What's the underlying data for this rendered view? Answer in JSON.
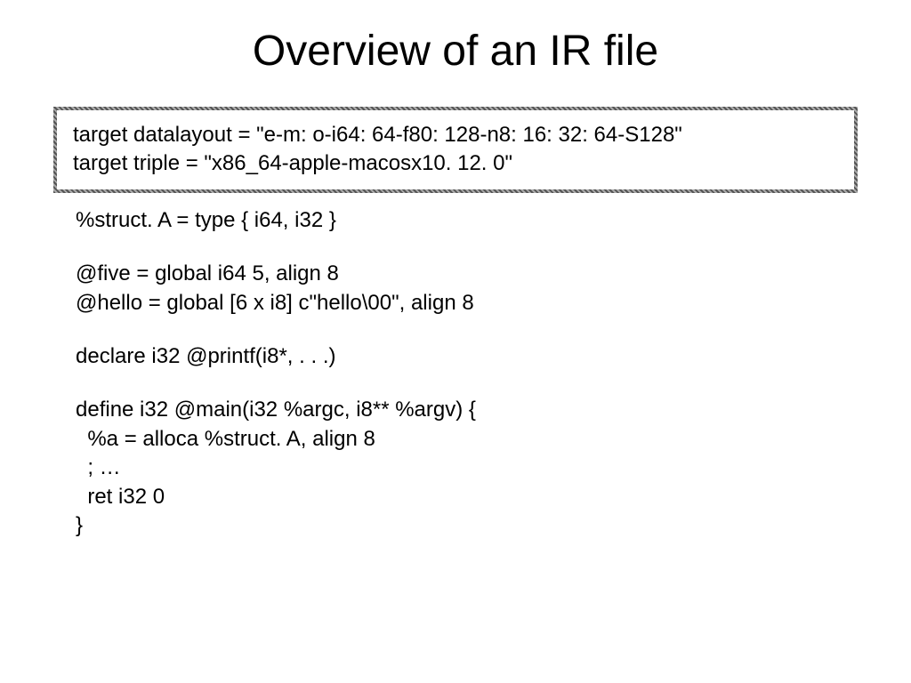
{
  "title": "Overview of an IR file",
  "highlighted": {
    "line1": "target datalayout = \"e-m: o-i64: 64-f80: 128-n8: 16: 32: 64-S128\"",
    "line2": "target triple = \"x86_64-apple-macosx10. 12. 0\""
  },
  "code": {
    "struct_line": "%struct. A = type { i64, i32 }",
    "five_line": "@five = global i64 5, align 8",
    "hello_line": "@hello = global [6 x i8] c\"hello\\00\", align 8",
    "declare_line": "declare i32 @printf(i8*, . . .)",
    "define_line": "define i32 @main(i32 %argc, i8** %argv) {",
    "alloca_line": "  %a = alloca %struct. A, align 8",
    "ellipsis_line": "  ; …",
    "ret_line": "  ret i32 0",
    "close_brace": "}"
  }
}
